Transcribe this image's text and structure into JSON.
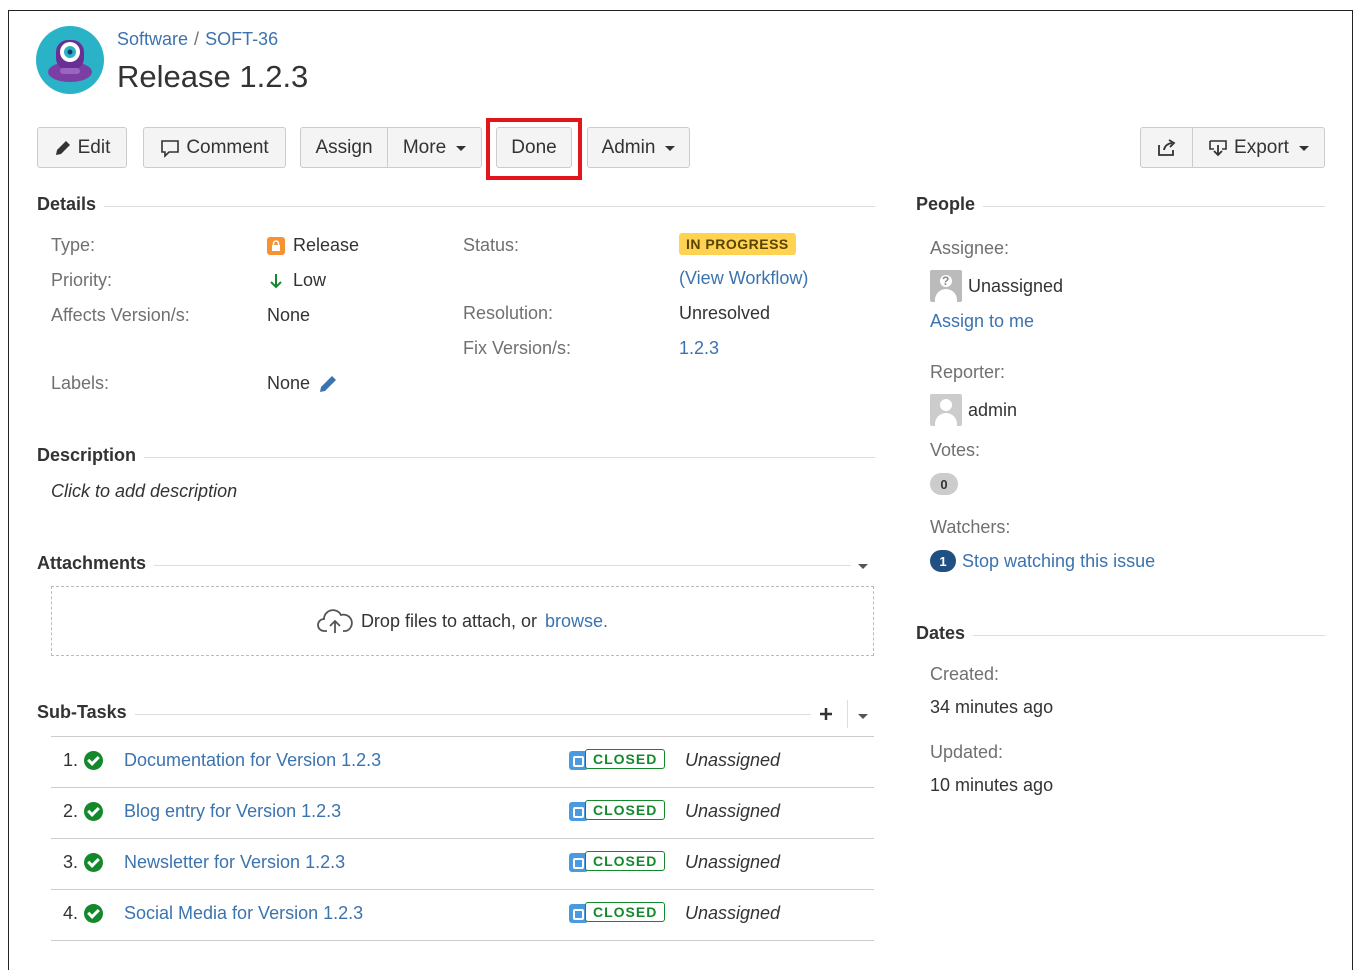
{
  "header": {
    "breadcrumb": {
      "project": "Software",
      "issue_key": "SOFT-36"
    },
    "title": "Release 1.2.3"
  },
  "toolbar": {
    "edit": "Edit",
    "comment": "Comment",
    "assign": "Assign",
    "more": "More",
    "done": "Done",
    "admin": "Admin",
    "export": "Export"
  },
  "details": {
    "section": "Details",
    "type_label": "Type:",
    "type_value": "Release",
    "priority_label": "Priority:",
    "priority_value": "Low",
    "affects_label": "Affects Version/s:",
    "affects_value": "None",
    "labels_label": "Labels:",
    "labels_value": "None",
    "status_label": "Status:",
    "status_value": "IN PROGRESS",
    "view_workflow": "View Workflow",
    "resolution_label": "Resolution:",
    "resolution_value": "Unresolved",
    "fix_label": "Fix Version/s:",
    "fix_value": "1.2.3"
  },
  "description": {
    "section": "Description",
    "placeholder": "Click to add description"
  },
  "attachments": {
    "section": "Attachments",
    "drop_text": "Drop files to attach, or",
    "browse": "browse."
  },
  "subtasks": {
    "section": "Sub-Tasks",
    "items": [
      {
        "num": "1.",
        "title": "Documentation for Version 1.2.3",
        "status": "CLOSED",
        "assignee": "Unassigned"
      },
      {
        "num": "2.",
        "title": "Blog entry for Version 1.2.3",
        "status": "CLOSED",
        "assignee": "Unassigned"
      },
      {
        "num": "3.",
        "title": "Newsletter for Version 1.2.3",
        "status": "CLOSED",
        "assignee": "Unassigned"
      },
      {
        "num": "4.",
        "title": "Social Media for Version 1.2.3",
        "status": "CLOSED",
        "assignee": "Unassigned"
      }
    ]
  },
  "people": {
    "section": "People",
    "assignee_label": "Assignee:",
    "assignee_value": "Unassigned",
    "assign_to_me": "Assign to me",
    "reporter_label": "Reporter:",
    "reporter_value": "admin",
    "votes_label": "Votes:",
    "votes_count": "0",
    "watchers_label": "Watchers:",
    "watchers_count": "1",
    "stop_watching": "Stop watching this issue"
  },
  "dates": {
    "section": "Dates",
    "created_label": "Created:",
    "created_value": "34 minutes ago",
    "updated_label": "Updated:",
    "updated_value": "10 minutes ago"
  },
  "colors": {
    "link": "#3b73af",
    "highlight": "#e3151a",
    "in_progress": "#ffd351",
    "closed": "#14892c"
  }
}
